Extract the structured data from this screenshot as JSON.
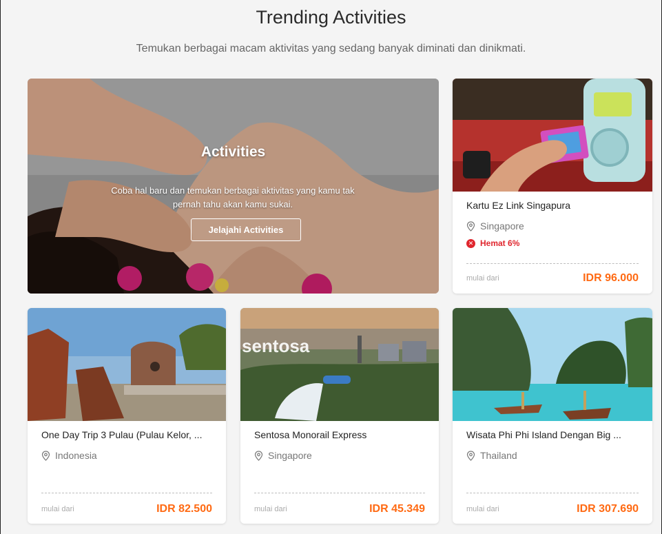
{
  "header": {
    "title": "Trending Activities",
    "subtitle": "Temukan berbagai macam aktivitas yang sedang banyak diminati dan dinikmati."
  },
  "hero": {
    "title": "Activities",
    "description": "Coba hal baru dan temukan berbagai aktivitas yang kamu tak pernah tahu akan kamu sukai.",
    "button_label": "Jelajahi Activities"
  },
  "price_prefix": "mulai dari",
  "cards": [
    {
      "name": "Kartu Ez Link Singapura",
      "location": "Singapore",
      "promo": "Hemat 6%",
      "price": "IDR 96.000"
    },
    {
      "name": "One Day Trip 3 Pulau (Pulau Kelor, ...",
      "location": "Indonesia",
      "price": "IDR 82.500"
    },
    {
      "name": "Sentosa Monorail Express",
      "location": "Singapore",
      "price": "IDR 45.349",
      "image_sign": "sentosa"
    },
    {
      "name": "Wisata Phi Phi Island Dengan Big ...",
      "location": "Thailand",
      "price": "IDR 307.690"
    }
  ],
  "colors": {
    "price": "#ff6a13",
    "promo": "#e0262e",
    "background": "#f4f4f4"
  },
  "icons": {
    "location": "map-pin-icon",
    "promo": "discount-badge-icon"
  }
}
